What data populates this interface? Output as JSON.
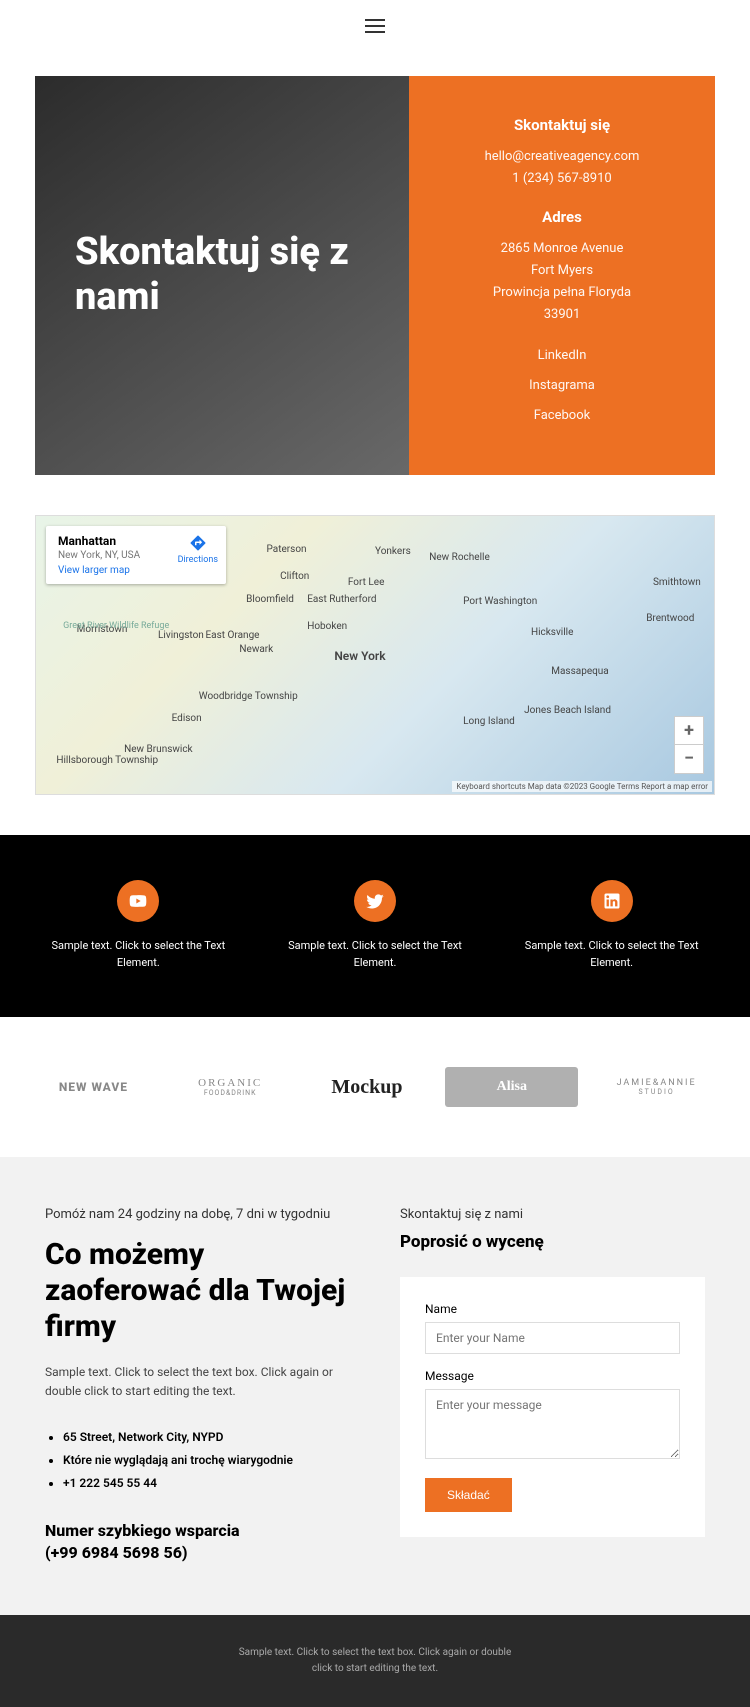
{
  "hero": {
    "title": "Skontaktuj się z nami",
    "contact_heading": "Skontaktuj się",
    "email": "hello@creativeagency.com",
    "phone": "1 (234) 567-8910",
    "address_heading": "Adres",
    "address": "2865 Monroe Avenue\nFort Myers\nProwincja pełna Floryda\n33901",
    "links": {
      "linkedin": "LinkedIn",
      "instagram": "Instagrama",
      "facebook": "Facebook"
    }
  },
  "map": {
    "title": "Manhattan",
    "subtitle": "New York, NY, USA",
    "larger": "View larger map",
    "directions": "Directions",
    "attribution": "Keyboard shortcuts   Map data ©2023 Google   Terms   Report a map error",
    "cities": {
      "newyork": "New York",
      "newark": "Newark",
      "yonkers": "Yonkers",
      "paterson": "Paterson",
      "clifton": "Clifton",
      "hoboken": "Hoboken",
      "rochelle": "New Rochelle",
      "livingston": "Livingston",
      "morristown": "Morristown",
      "bloomfield": "Bloomfield",
      "rutherford": "East Rutherford",
      "orange": "East Orange",
      "hicksville": "Hicksville",
      "massapequa": "Massapequa",
      "smithtown": "Smithtown",
      "fortlee": "Fort Lee",
      "island": "Long Island",
      "portwash": "Port Washington",
      "jonesbeach": "Jones Beach Island",
      "brentwood": "Brentwood",
      "edison": "Edison",
      "brunswick": "New Brunswick",
      "woodbridge": "Woodbridge Township",
      "hillsborough": "Hillsborough Township",
      "greatriver": "Great River Wildlife Refuge"
    }
  },
  "social": {
    "text1": "Sample text. Click to select the Text Element.",
    "text2": "Sample text. Click to select the Text Element.",
    "text3": "Sample text. Click to select the Text Element."
  },
  "logos": {
    "l1": "NEW WAVE",
    "l2": "ORGANIC",
    "l2_sub": "FOOD&DRINK",
    "l3": "Mockup",
    "l4": "Alisa",
    "l5": "JAMIE&ANNIE",
    "l5_sub": "STUDIO"
  },
  "offer": {
    "subtitle": "Pomóż nam 24 godziny na dobę, 7 dni w tygodniu",
    "heading": "Co możemy zaoferować dla Twojej firmy",
    "desc": "Sample text. Click to select the text box. Click again or double click to start editing the text.",
    "bullets": [
      "65 Street, Network City, NYPD",
      "Które nie wyglądają ani trochę wiarygodnie",
      "+1 222 545 55 44"
    ],
    "support_heading": "Numer szybkiego wsparcia\n(+99 6984 5698 56)"
  },
  "form": {
    "subtitle": "Skontaktuj się z nami",
    "heading": "Poprosić o wycenę",
    "name_label": "Name",
    "name_placeholder": "Enter your Name",
    "message_label": "Message",
    "message_placeholder": "Enter your message",
    "submit": "Składać"
  },
  "footer": {
    "text": "Sample text. Click to select the text box. Click again or double\nclick to start editing the text."
  }
}
